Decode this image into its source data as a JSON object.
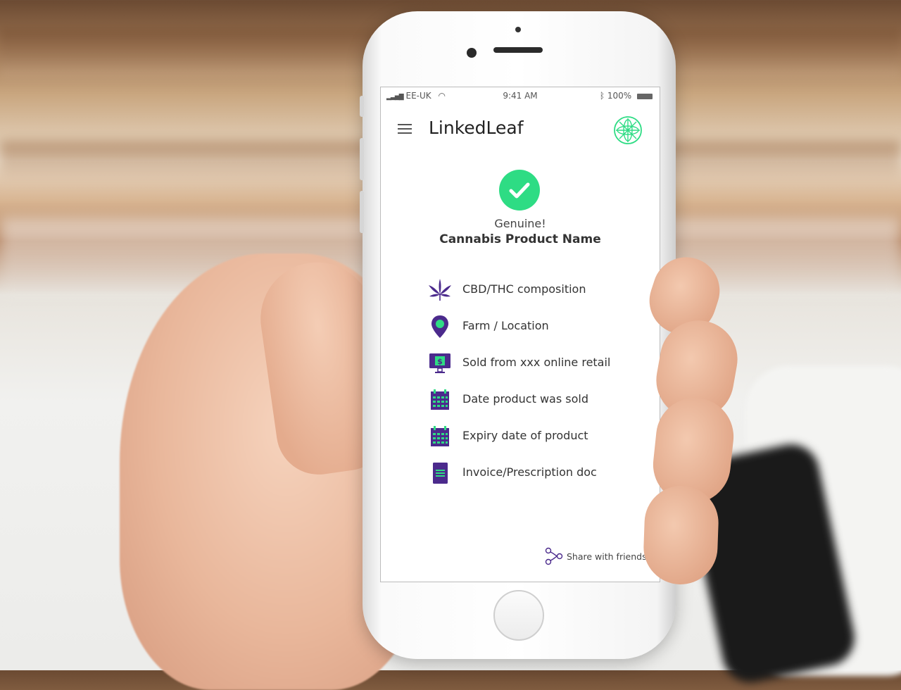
{
  "status_bar": {
    "carrier": "EE-UK",
    "time": "9:41 AM",
    "battery": "100%"
  },
  "app": {
    "title": "LinkedLeaf"
  },
  "verification": {
    "status": "Genuine!",
    "product_name": "Cannabis Product Name"
  },
  "info_items": [
    {
      "label": "CBD/THC composition",
      "icon": "cannabis-leaf-icon"
    },
    {
      "label": "Farm / Location",
      "icon": "location-pin-icon"
    },
    {
      "label": "Sold from xxx online retail",
      "icon": "monitor-dollar-icon"
    },
    {
      "label": "Date product was sold",
      "icon": "calendar-icon"
    },
    {
      "label": "Expiry date of product",
      "icon": "calendar-icon"
    },
    {
      "label": "Invoice/Prescription doc",
      "icon": "document-icon"
    }
  ],
  "share": {
    "label": "Share with friends",
    "icon": "share-icon"
  },
  "colors": {
    "accent_green": "#2edc84",
    "icon_purple": "#4b2a8c",
    "text": "#333333"
  }
}
